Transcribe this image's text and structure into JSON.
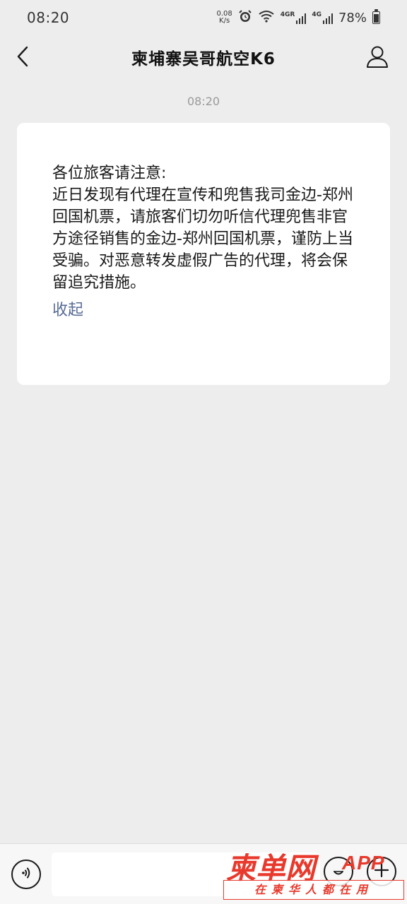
{
  "status_bar": {
    "time": "08:20",
    "net_speed_value": "0.08",
    "net_speed_unit": "K/s",
    "signal_1_label": "4GR",
    "signal_2_label": "4G",
    "battery": "78%"
  },
  "nav": {
    "title": "柬埔寨吴哥航空K6"
  },
  "chat": {
    "timestamp": "08:20",
    "notice_heading": "各位旅客请注意:",
    "notice_body": "近日发现有代理在宣传和兜售我司金边-郑州回国机票，请旅客们切勿听信代理兜售非官方途径销售的金边-郑州回国机票，谨防上当受骗。对恶意转发虚假广告的代理，将会保留追究措施。",
    "collapse_label": "收起"
  },
  "input_bar": {
    "placeholder": ""
  },
  "watermark": {
    "logo_text": "柬单网",
    "app_text": "APP",
    "tagline": "在柬华人都在用"
  },
  "colors": {
    "background": "#ededed",
    "card": "#ffffff",
    "link": "#576b95",
    "watermark": "#e8392c"
  }
}
